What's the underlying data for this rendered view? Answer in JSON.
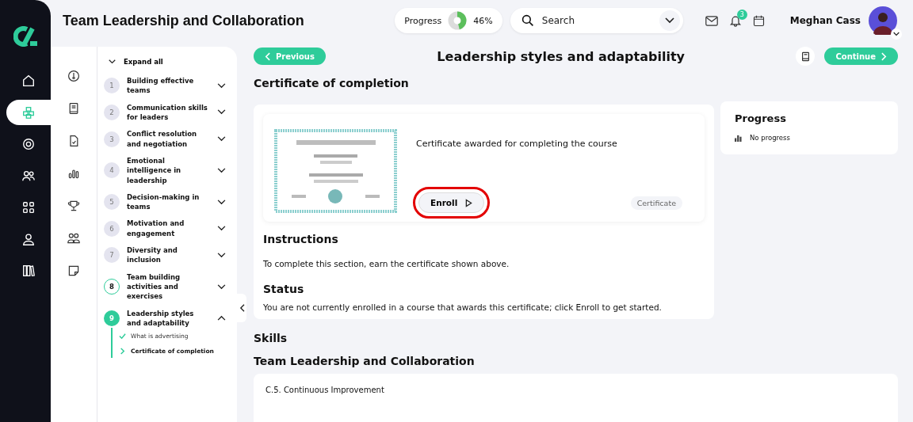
{
  "header": {
    "title": "Team Leadership and Collaboration",
    "progress": {
      "label": "Progress",
      "level": 0.46,
      "reading": "46%"
    },
    "search": {
      "placeholder": "Search"
    },
    "notifications": {
      "count": "3"
    },
    "user": {
      "name": "Meghan Cass"
    }
  },
  "nav": [
    {
      "selected": false
    },
    {
      "selected": true
    },
    {
      "selected": false
    },
    {
      "selected": false
    },
    {
      "selected": false
    },
    {
      "selected": false
    },
    {
      "selected": false
    }
  ],
  "outline": {
    "expand_all": "Expand all",
    "items": [
      {
        "number": "1",
        "title": "Building effective teams",
        "kind": "pending",
        "expanded": false
      },
      {
        "number": "2",
        "title": "Communication skills for leaders",
        "kind": "pending",
        "expanded": false
      },
      {
        "number": "3",
        "title": "Conflict resolution and negotiation",
        "kind": "pending",
        "expanded": false
      },
      {
        "number": "4",
        "title": "Emotional intelligence in leadership",
        "kind": "pending",
        "expanded": false
      },
      {
        "number": "5",
        "title": "Decision-making in teams",
        "kind": "pending",
        "expanded": false
      },
      {
        "number": "6",
        "title": "Motivation and engagement",
        "kind": "pending",
        "expanded": false
      },
      {
        "number": "7",
        "title": "Diversity and inclusion",
        "kind": "pending",
        "expanded": false
      },
      {
        "number": "8",
        "title": "Team building activities and exercises",
        "kind": "visited",
        "expanded": false
      },
      {
        "number": "9",
        "title": "Leadership styles and adaptability",
        "kind": "current",
        "expanded": true,
        "children": [
          {
            "title": "What is advertising",
            "kind": "done",
            "selected": false
          },
          {
            "title": "Certificate of completion",
            "kind": "current",
            "selected": true
          }
        ]
      }
    ]
  },
  "lesson": {
    "previous": "Previous",
    "title": "Leadership styles and adaptability",
    "continue": "Continue",
    "section": "Certificate of completion",
    "certificate": {
      "description": "Certificate awarded for completing the course",
      "enroll": "Enroll",
      "highlighted": true,
      "tag": "Certificate"
    },
    "instructions": {
      "heading": "Instructions",
      "text": "To complete this section, earn the certificate shown above."
    },
    "status": {
      "heading": "Status",
      "text": "You are not currently enrolled in a course that awards this certificate; click Enroll to get started."
    },
    "skills": {
      "heading": "Skills",
      "group": "Team Leadership and Collaboration",
      "items": [
        "C.5. Continuous Improvement"
      ]
    }
  },
  "progress_card": {
    "title": "Progress",
    "text": "No progress"
  }
}
